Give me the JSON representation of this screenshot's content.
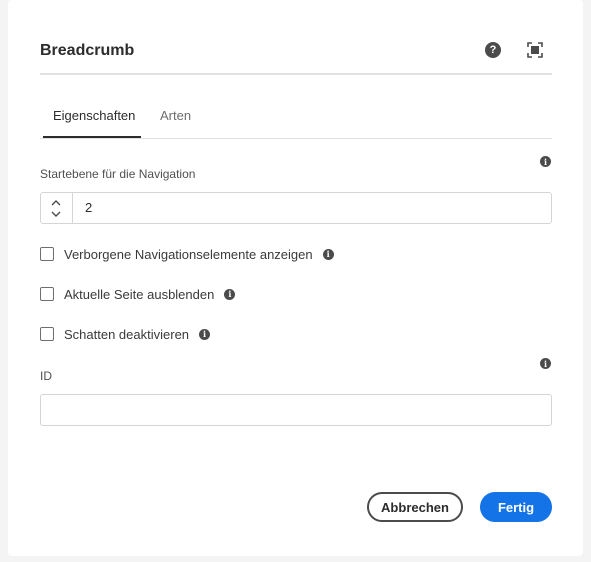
{
  "dialog": {
    "title": "Breadcrumb",
    "help_icon": "help-icon",
    "fullscreen_icon": "fullscreen-icon"
  },
  "tabs": [
    {
      "label": "Eigenschaften",
      "active": true
    },
    {
      "label": "Arten",
      "active": false
    }
  ],
  "fields": {
    "start_level": {
      "label": "Startebene für die Navigation",
      "value": "2"
    },
    "checkboxes": [
      {
        "label": "Verborgene Navigationselemente anzeigen",
        "checked": false
      },
      {
        "label": "Aktuelle Seite ausblenden",
        "checked": false
      },
      {
        "label": "Schatten deaktivieren",
        "checked": false
      }
    ],
    "id": {
      "label": "ID",
      "value": ""
    }
  },
  "buttons": {
    "cancel": "Abbrechen",
    "done": "Fertig"
  },
  "colors": {
    "accent": "#1473e6",
    "text": "#2c2c2c",
    "divider": "#e1e1e1"
  }
}
